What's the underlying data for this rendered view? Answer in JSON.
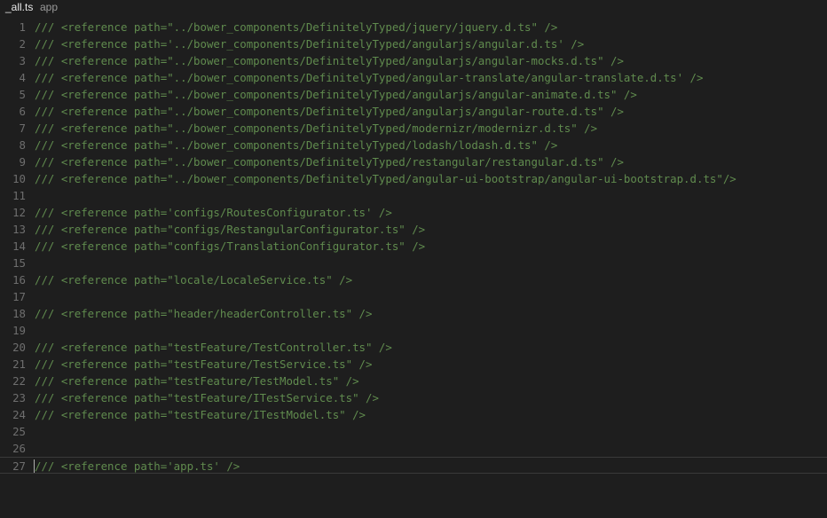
{
  "window": {
    "file_name": "_all.ts",
    "folder_name": "app"
  },
  "editor": {
    "lines": [
      {
        "num": "1",
        "text": "/// <reference path=\"../bower_components/DefinitelyTyped/jquery/jquery.d.ts\" />"
      },
      {
        "num": "2",
        "text": "/// <reference path='../bower_components/DefinitelyTyped/angularjs/angular.d.ts' />"
      },
      {
        "num": "3",
        "text": "/// <reference path=\"../bower_components/DefinitelyTyped/angularjs/angular-mocks.d.ts\" />"
      },
      {
        "num": "4",
        "text": "/// <reference path=\"../bower_components/DefinitelyTyped/angular-translate/angular-translate.d.ts' />"
      },
      {
        "num": "5",
        "text": "/// <reference path=\"../bower_components/DefinitelyTyped/angularjs/angular-animate.d.ts\" />"
      },
      {
        "num": "6",
        "text": "/// <reference path=\"../bower_components/DefinitelyTyped/angularjs/angular-route.d.ts\" />"
      },
      {
        "num": "7",
        "text": "/// <reference path=\"../bower_components/DefinitelyTyped/modernizr/modernizr.d.ts\" />"
      },
      {
        "num": "8",
        "text": "/// <reference path=\"../bower_components/DefinitelyTyped/lodash/lodash.d.ts\" />"
      },
      {
        "num": "9",
        "text": "/// <reference path=\"../bower_components/DefinitelyTyped/restangular/restangular.d.ts\" />"
      },
      {
        "num": "10",
        "text": "/// <reference path=\"../bower_components/DefinitelyTyped/angular-ui-bootstrap/angular-ui-bootstrap.d.ts\"/>"
      },
      {
        "num": "11",
        "text": ""
      },
      {
        "num": "12",
        "text": "/// <reference path='configs/RoutesConfigurator.ts' />"
      },
      {
        "num": "13",
        "text": "/// <reference path=\"configs/RestangularConfigurator.ts\" />"
      },
      {
        "num": "14",
        "text": "/// <reference path=\"configs/TranslationConfigurator.ts\" />"
      },
      {
        "num": "15",
        "text": ""
      },
      {
        "num": "16",
        "text": "/// <reference path=\"locale/LocaleService.ts\" />"
      },
      {
        "num": "17",
        "text": ""
      },
      {
        "num": "18",
        "text": "/// <reference path=\"header/headerController.ts\" />"
      },
      {
        "num": "19",
        "text": ""
      },
      {
        "num": "20",
        "text": "/// <reference path=\"testFeature/TestController.ts\" />"
      },
      {
        "num": "21",
        "text": "/// <reference path=\"testFeature/TestService.ts\" />"
      },
      {
        "num": "22",
        "text": "/// <reference path=\"testFeature/TestModel.ts\" />"
      },
      {
        "num": "23",
        "text": "/// <reference path=\"testFeature/ITestService.ts\" />"
      },
      {
        "num": "24",
        "text": "/// <reference path=\"testFeature/ITestModel.ts\" />"
      },
      {
        "num": "25",
        "text": ""
      },
      {
        "num": "26",
        "text": ""
      },
      {
        "num": "27",
        "text": "/// <reference path='app.ts' />"
      }
    ],
    "current_line_index": 26
  },
  "colors": {
    "background": "#1e1e1e",
    "comment": "#608b4e",
    "line_number": "#6e6e6e",
    "title_text": "#e8e8e8",
    "folder_text": "#9a9a9a"
  }
}
